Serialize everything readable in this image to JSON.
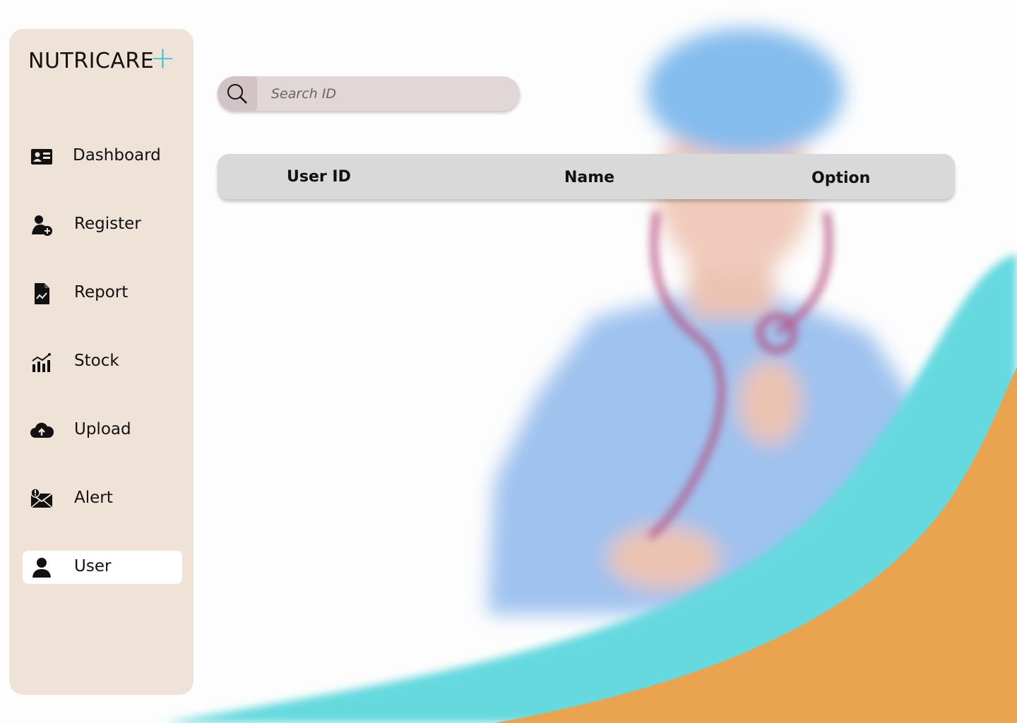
{
  "app": {
    "logo_text": "NUTRICARE",
    "logo_symbol": "+",
    "accent_color": "#3cc4d2"
  },
  "sidebar": {
    "items": [
      {
        "label": "Dashboard",
        "icon": "id-card-icon",
        "active": false
      },
      {
        "label": "Register",
        "icon": "user-plus-icon",
        "active": false
      },
      {
        "label": "Report",
        "icon": "file-chart-icon",
        "active": false
      },
      {
        "label": "Stock",
        "icon": "bar-chart-icon",
        "active": false
      },
      {
        "label": "Upload",
        "icon": "cloud-upload-icon",
        "active": false
      },
      {
        "label": "Alert",
        "icon": "mail-alert-icon",
        "active": false
      },
      {
        "label": "User",
        "icon": "user-icon",
        "active": true
      }
    ]
  },
  "search": {
    "placeholder": "Search ID",
    "value": ""
  },
  "table": {
    "columns": [
      "User ID",
      "Name",
      "Option"
    ],
    "rows": []
  },
  "colors": {
    "sidebar_bg": "#efe2d7",
    "wave_teal": "#66d9df",
    "wave_orange": "#eaa450"
  }
}
